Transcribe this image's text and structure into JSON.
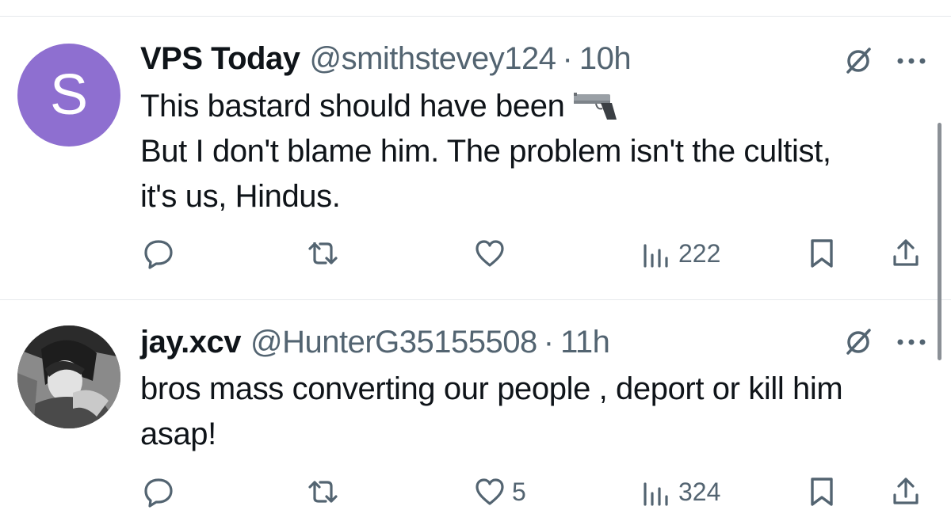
{
  "tweets": [
    {
      "avatar_letter": "S",
      "avatar_color": "#8e6fd0",
      "name": "VPS Today",
      "handle": "@smithstevey124",
      "separator": "·",
      "time": "10h",
      "lines": [
        "This bastard should have been",
        "But I don't blame him. The problem isn't the cultist,",
        "it's us, Hindus."
      ],
      "emoji": "pistol-icon",
      "actions": {
        "reply_count": "",
        "retweet_count": "",
        "like_count": "",
        "views_count": "222"
      }
    },
    {
      "avatar_description": "anime-avatar",
      "name": "jay.xcv",
      "handle": "@HunterG35155508",
      "separator": "·",
      "time": "11h",
      "lines": [
        "bros mass converting our people , deport or kill him",
        "asap!"
      ],
      "actions": {
        "reply_count": "",
        "retweet_count": "",
        "like_count": "5",
        "views_count": "324"
      }
    }
  ],
  "icons": {
    "reply": "reply-icon",
    "retweet": "retweet-icon",
    "like": "heart-icon",
    "views": "views-icon",
    "bookmark": "bookmark-icon",
    "share": "share-icon",
    "grok": "grok-icon",
    "more": "more-icon"
  },
  "colors": {
    "text": "#0f1419",
    "secondary": "#536471",
    "divider": "#e6e9ec"
  }
}
